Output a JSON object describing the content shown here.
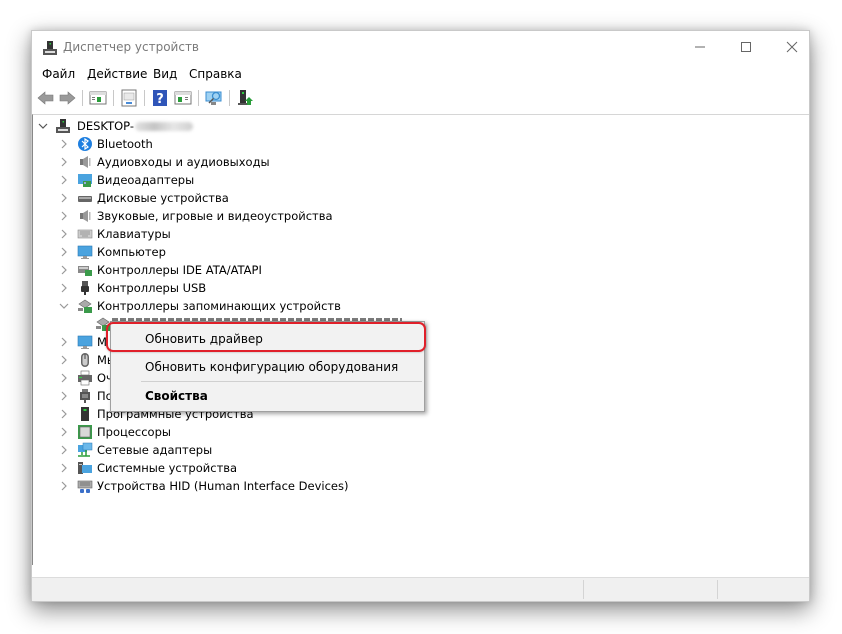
{
  "window": {
    "title": "Диспетчер устройств",
    "controls": {
      "minimize": "minimize",
      "maximize": "maximize",
      "close": "close"
    }
  },
  "menubar": {
    "items": [
      {
        "label": "Файл"
      },
      {
        "label": "Действие"
      },
      {
        "label": "Вид"
      },
      {
        "label": "Справка"
      }
    ]
  },
  "toolbar": {
    "buttons": [
      {
        "icon": "back-arrow-icon"
      },
      {
        "icon": "forward-arrow-icon"
      },
      {
        "icon": "show-hide-console-tree-icon"
      },
      {
        "icon": "properties-icon"
      },
      {
        "icon": "help-icon"
      },
      {
        "icon": "show-action-pane-icon"
      },
      {
        "icon": "scan-hardware-icon"
      },
      {
        "icon": "update-driver-icon"
      }
    ]
  },
  "tree": {
    "root": {
      "label": "DESKTOP-",
      "expanded": true,
      "name_obscured": true
    },
    "items": [
      {
        "label": "Bluetooth",
        "icon": "bluetooth-icon",
        "expanded": false
      },
      {
        "label": "Аудиовходы и аудиовыходы",
        "icon": "speaker-icon",
        "expanded": false
      },
      {
        "label": "Видеоадаптеры",
        "icon": "display-adapter-icon",
        "expanded": false
      },
      {
        "label": "Дисковые устройства",
        "icon": "disk-drive-icon",
        "expanded": false
      },
      {
        "label": "Звуковые, игровые и видеоустройства",
        "icon": "speaker-icon",
        "expanded": false
      },
      {
        "label": "Клавиатуры",
        "icon": "keyboard-icon",
        "expanded": false
      },
      {
        "label": "Компьютер",
        "icon": "monitor-icon",
        "expanded": false
      },
      {
        "label": "Контроллеры IDE ATA/ATAPI",
        "icon": "ide-controller-icon",
        "expanded": false
      },
      {
        "label": "Контроллеры USB",
        "icon": "usb-icon",
        "expanded": false
      },
      {
        "label": "Контроллеры запоминающих устройств",
        "icon": "storage-controller-icon",
        "expanded": true
      },
      {
        "label": "",
        "icon": "storage-controller-icon",
        "child": true,
        "obscured": true
      },
      {
        "label": "М",
        "icon": "monitor-icon",
        "expanded": false
      },
      {
        "label": "Мы",
        "icon": "mouse-icon",
        "expanded": false
      },
      {
        "label": "Оч",
        "icon": "printer-icon",
        "expanded": false
      },
      {
        "label": "По",
        "icon": "port-icon",
        "expanded": false
      },
      {
        "label": "Программные устройства",
        "icon": "software-device-icon",
        "expanded": false
      },
      {
        "label": "Процессоры",
        "icon": "processor-icon",
        "expanded": false
      },
      {
        "label": "Сетевые адаптеры",
        "icon": "network-adapter-icon",
        "expanded": false
      },
      {
        "label": "Системные устройства",
        "icon": "system-device-icon",
        "expanded": false
      },
      {
        "label": "Устройства HID (Human Interface Devices)",
        "icon": "hid-icon",
        "expanded": false
      }
    ]
  },
  "context_menu": {
    "items": [
      {
        "label": "Обновить драйвер",
        "highlighted": true
      },
      {
        "label": "Обновить конфигурацию оборудования"
      },
      {
        "label": "Свойства",
        "bold": true
      }
    ],
    "highlight_color": "#e0202a"
  }
}
